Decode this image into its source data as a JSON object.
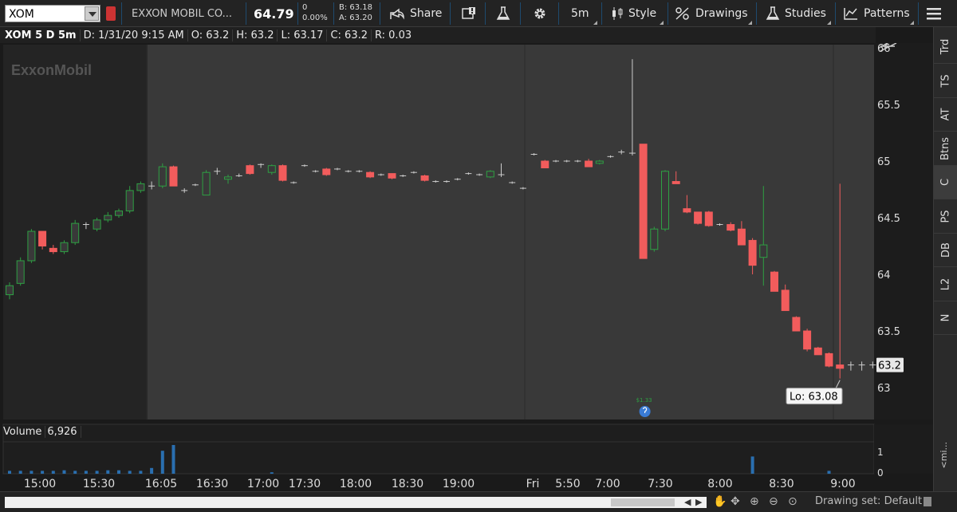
{
  "toolbar": {
    "symbol": "XOM",
    "company": "EXXON MOBIL CO...",
    "last": "64.79",
    "change": "0",
    "change_pct": "0.00%",
    "bid": "B: 63.18",
    "ask": "A: 63.20",
    "share_label": "Share",
    "timeframe": "5m",
    "style_label": "Style",
    "drawings_label": "Drawings",
    "studies_label": "Studies",
    "patterns_label": "Patterns"
  },
  "info_row": {
    "symbol": "XOM 5 D 5m",
    "date": "D: 1/31/20 9:15 AM",
    "open": "O: 63.2",
    "high": "H: 63.2",
    "low": "L: 63.17",
    "close": "C: 63.2",
    "range": "R: 0.03"
  },
  "volume": {
    "label": "Volume",
    "value": "6,926",
    "axis_ticks": [
      "1",
      "0"
    ]
  },
  "watermark": "ExxonMobil",
  "event_marker": {
    "label": "$1.33"
  },
  "sidebar": [
    "Trd",
    "TS",
    "AT",
    "Btns",
    "C",
    "PS",
    "DB",
    "L2",
    "N"
  ],
  "bottom": {
    "drawing_set": "Drawing set: Default",
    "mi_label": "<mi..."
  },
  "colors": {
    "up": "#2ea043",
    "down": "#f25c5c",
    "bg_premarket": "#242424",
    "bg_session": "#393939",
    "price_tag": "#e8e8e8"
  },
  "chart_data": {
    "type": "candlestick",
    "title": "",
    "xlabel": "",
    "ylabel": "",
    "ylim": [
      62.6,
      66.05
    ],
    "y_ticks": [
      63,
      63.5,
      64,
      64.5,
      65,
      65.5,
      66
    ],
    "x_ticks": [
      "15:00",
      "15:30",
      "16:05",
      "16:30",
      "17:00",
      "17:30",
      "18:00",
      "18:30",
      "19:00",
      "Fri",
      "5:50",
      "7:00",
      "7:30",
      "8:00",
      "8:30",
      "9:00"
    ],
    "last_price_tag": "63.2",
    "low_annotation": "Lo: 63.08",
    "candles": [
      {
        "o": 63.82,
        "h": 63.93,
        "l": 63.78,
        "c": 63.9
      },
      {
        "o": 63.92,
        "h": 64.15,
        "l": 63.9,
        "c": 64.12
      },
      {
        "o": 64.12,
        "h": 64.4,
        "l": 64.1,
        "c": 64.38
      },
      {
        "o": 64.38,
        "h": 64.38,
        "l": 64.22,
        "c": 64.25
      },
      {
        "o": 64.23,
        "h": 64.26,
        "l": 64.18,
        "c": 64.2
      },
      {
        "o": 64.2,
        "h": 64.3,
        "l": 64.18,
        "c": 64.28
      },
      {
        "o": 64.28,
        "h": 64.48,
        "l": 64.26,
        "c": 64.45
      },
      {
        "o": 64.45,
        "h": 64.46,
        "l": 64.4,
        "c": 64.44
      },
      {
        "o": 64.4,
        "h": 64.5,
        "l": 64.38,
        "c": 64.48
      },
      {
        "o": 64.48,
        "h": 64.55,
        "l": 64.46,
        "c": 64.52
      },
      {
        "o": 64.52,
        "h": 64.58,
        "l": 64.5,
        "c": 64.56
      },
      {
        "o": 64.56,
        "h": 64.78,
        "l": 64.54,
        "c": 64.74
      },
      {
        "o": 64.74,
        "h": 64.82,
        "l": 64.72,
        "c": 64.8
      },
      {
        "o": 64.78,
        "h": 64.82,
        "l": 64.75,
        "c": 64.78
      },
      {
        "o": 64.78,
        "h": 64.98,
        "l": 64.76,
        "c": 64.95
      },
      {
        "o": 64.95,
        "h": 64.96,
        "l": 64.78,
        "c": 64.78
      },
      {
        "o": 64.74,
        "h": 64.76,
        "l": 64.72,
        "c": 64.74
      },
      {
        "o": 64.79,
        "h": 64.8,
        "l": 64.78,
        "c": 64.79
      },
      {
        "o": 64.7,
        "h": 64.92,
        "l": 64.7,
        "c": 64.9
      },
      {
        "o": 64.9,
        "h": 64.94,
        "l": 64.88,
        "c": 64.91
      },
      {
        "o": 64.84,
        "h": 64.88,
        "l": 64.8,
        "c": 64.86
      },
      {
        "o": 64.87,
        "h": 64.89,
        "l": 64.86,
        "c": 64.87
      },
      {
        "o": 64.96,
        "h": 64.97,
        "l": 64.88,
        "c": 64.89
      },
      {
        "o": 64.96,
        "h": 64.98,
        "l": 64.94,
        "c": 64.97
      },
      {
        "o": 64.9,
        "h": 64.97,
        "l": 64.88,
        "c": 64.96
      },
      {
        "o": 64.96,
        "h": 64.97,
        "l": 64.82,
        "c": 64.83
      },
      {
        "o": 64.81,
        "h": 64.82,
        "l": 64.8,
        "c": 64.81
      },
      {
        "o": 64.96,
        "h": 64.97,
        "l": 64.95,
        "c": 64.96
      },
      {
        "o": 64.91,
        "h": 64.92,
        "l": 64.9,
        "c": 64.91
      },
      {
        "o": 64.93,
        "h": 64.94,
        "l": 64.87,
        "c": 64.88
      },
      {
        "o": 64.93,
        "h": 64.94,
        "l": 64.92,
        "c": 64.93
      },
      {
        "o": 64.91,
        "h": 64.92,
        "l": 64.9,
        "c": 64.91
      },
      {
        "o": 64.91,
        "h": 64.92,
        "l": 64.9,
        "c": 64.91
      },
      {
        "o": 64.9,
        "h": 64.91,
        "l": 64.85,
        "c": 64.86
      },
      {
        "o": 64.88,
        "h": 64.89,
        "l": 64.87,
        "c": 64.88
      },
      {
        "o": 64.89,
        "h": 64.89,
        "l": 64.84,
        "c": 64.85
      },
      {
        "o": 64.87,
        "h": 64.88,
        "l": 64.86,
        "c": 64.87
      },
      {
        "o": 64.9,
        "h": 64.91,
        "l": 64.89,
        "c": 64.9
      },
      {
        "o": 64.87,
        "h": 64.88,
        "l": 64.82,
        "c": 64.83
      },
      {
        "o": 64.82,
        "h": 64.83,
        "l": 64.81,
        "c": 64.82
      },
      {
        "o": 64.82,
        "h": 64.83,
        "l": 64.81,
        "c": 64.82
      },
      {
        "o": 64.84,
        "h": 64.85,
        "l": 64.83,
        "c": 64.84
      },
      {
        "o": 64.89,
        "h": 64.9,
        "l": 64.88,
        "c": 64.89
      },
      {
        "o": 64.88,
        "h": 64.89,
        "l": 64.87,
        "c": 64.88
      },
      {
        "o": 64.86,
        "h": 64.92,
        "l": 64.85,
        "c": 64.91
      },
      {
        "o": 64.88,
        "h": 64.98,
        "l": 64.86,
        "c": 64.88
      },
      {
        "o": 64.81,
        "h": 64.82,
        "l": 64.8,
        "c": 64.81
      },
      {
        "o": 64.76,
        "h": 64.77,
        "l": 64.75,
        "c": 64.76
      },
      {
        "o": 65.06,
        "h": 65.07,
        "l": 65.05,
        "c": 65.06
      },
      {
        "o": 65.0,
        "h": 65.01,
        "l": 64.94,
        "c": 64.94
      },
      {
        "o": 65.0,
        "h": 65.01,
        "l": 64.99,
        "c": 65.0
      },
      {
        "o": 65.0,
        "h": 65.01,
        "l": 64.99,
        "c": 65.0
      },
      {
        "o": 65.0,
        "h": 65.01,
        "l": 64.99,
        "c": 65.0
      },
      {
        "o": 65.0,
        "h": 65.02,
        "l": 64.95,
        "c": 64.95
      },
      {
        "o": 64.98,
        "h": 65.01,
        "l": 64.97,
        "c": 65.0
      },
      {
        "o": 65.04,
        "h": 65.05,
        "l": 65.03,
        "c": 65.04
      },
      {
        "o": 65.08,
        "h": 65.1,
        "l": 65.06,
        "c": 65.08
      },
      {
        "o": 65.08,
        "h": 65.9,
        "l": 65.05,
        "c": 65.07
      },
      {
        "o": 65.15,
        "h": 65.15,
        "l": 64.14,
        "c": 64.14
      },
      {
        "o": 64.22,
        "h": 64.42,
        "l": 64.2,
        "c": 64.4
      },
      {
        "o": 64.4,
        "h": 64.92,
        "l": 64.38,
        "c": 64.91
      },
      {
        "o": 64.82,
        "h": 64.91,
        "l": 64.8,
        "c": 64.8
      },
      {
        "o": 64.58,
        "h": 64.7,
        "l": 64.54,
        "c": 64.55
      },
      {
        "o": 64.55,
        "h": 64.55,
        "l": 64.44,
        "c": 64.45
      },
      {
        "o": 64.55,
        "h": 64.56,
        "l": 64.42,
        "c": 64.43
      },
      {
        "o": 64.44,
        "h": 64.45,
        "l": 64.43,
        "c": 64.44
      },
      {
        "o": 64.44,
        "h": 64.46,
        "l": 64.38,
        "c": 64.39
      },
      {
        "o": 64.4,
        "h": 64.47,
        "l": 64.26,
        "c": 64.26
      },
      {
        "o": 64.3,
        "h": 64.32,
        "l": 64.0,
        "c": 64.08
      },
      {
        "o": 64.15,
        "h": 64.78,
        "l": 63.9,
        "c": 64.26
      },
      {
        "o": 64.02,
        "h": 64.03,
        "l": 63.85,
        "c": 63.85
      },
      {
        "o": 63.86,
        "h": 63.91,
        "l": 63.68,
        "c": 63.68
      },
      {
        "o": 63.62,
        "h": 63.63,
        "l": 63.5,
        "c": 63.5
      },
      {
        "o": 63.5,
        "h": 63.52,
        "l": 63.32,
        "c": 63.34
      },
      {
        "o": 63.35,
        "h": 63.36,
        "l": 63.29,
        "c": 63.29
      },
      {
        "o": 63.3,
        "h": 63.31,
        "l": 63.18,
        "c": 63.19
      },
      {
        "o": 63.2,
        "h": 64.8,
        "l": 63.08,
        "c": 63.17
      },
      {
        "o": 63.2,
        "h": 63.23,
        "l": 63.15,
        "c": 63.2
      },
      {
        "o": 63.2,
        "h": 63.23,
        "l": 63.15,
        "c": 63.2
      },
      {
        "o": 63.2,
        "h": 63.23,
        "l": 63.17,
        "c": 63.2
      }
    ],
    "volume_relative": [
      0.1,
      0.1,
      0.1,
      0.1,
      0.1,
      0.12,
      0.1,
      0.1,
      0.1,
      0.12,
      0.12,
      0.1,
      0.1,
      0.2,
      0.8,
      1.0,
      0,
      0,
      0,
      0,
      0,
      0,
      0,
      0,
      0.05,
      0,
      0,
      0,
      0,
      0,
      0,
      0,
      0,
      0,
      0,
      0,
      0,
      0,
      0,
      0,
      0,
      0,
      0,
      0,
      0,
      0,
      0,
      0,
      0,
      0,
      0,
      0,
      0,
      0,
      0,
      0,
      0,
      0,
      0,
      0,
      0,
      0,
      0,
      0,
      0,
      0,
      0,
      0,
      0.6,
      0,
      0,
      0,
      0,
      0,
      0,
      0.1,
      0,
      0,
      0
    ]
  }
}
